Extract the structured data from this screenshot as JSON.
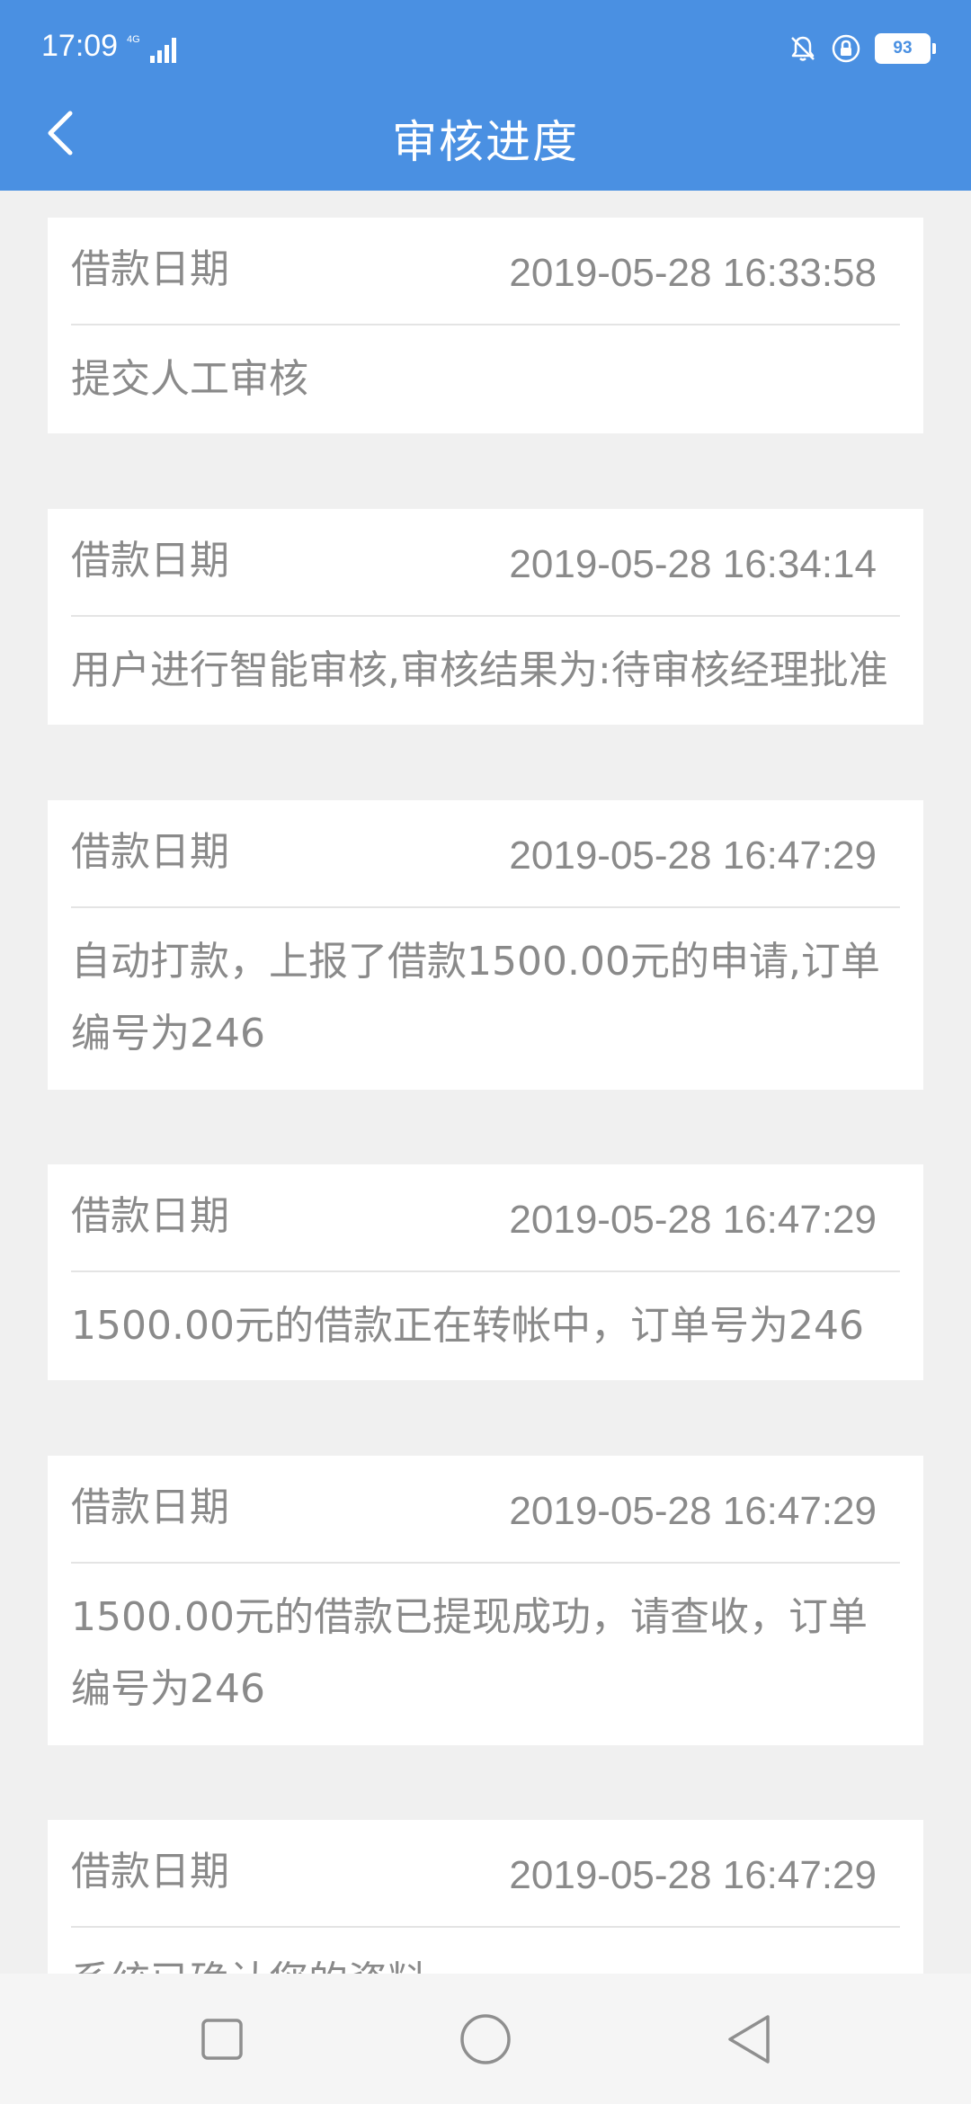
{
  "status_bar": {
    "time": "17:09",
    "network": "4G",
    "battery": "93"
  },
  "header": {
    "title": "审核进度"
  },
  "records": [
    {
      "label": "借款日期",
      "date": "2019-05-28 16:33:58",
      "description": "提交人工审核"
    },
    {
      "label": "借款日期",
      "date": "2019-05-28 16:34:14",
      "description": "用户进行智能审核,审核结果为:待审核经理批准"
    },
    {
      "label": "借款日期",
      "date": "2019-05-28 16:47:29",
      "description": "自动打款，上报了借款1500.00元的申请,订单编号为246"
    },
    {
      "label": "借款日期",
      "date": "2019-05-28 16:47:29",
      "description": "1500.00元的借款正在转帐中，订单号为246"
    },
    {
      "label": "借款日期",
      "date": "2019-05-28 16:47:29",
      "description": "1500.00元的借款已提现成功，请查收，订单编号为246"
    },
    {
      "label": "借款日期",
      "date": "2019-05-28 16:47:29",
      "description": "系统已确认您的资料"
    }
  ],
  "colors": {
    "header": "#4a90e2",
    "page_background": "#f0f0f0",
    "card_background": "#ffffff",
    "text": "#8a8a8a"
  },
  "icons": {
    "back": "chevron-left-icon",
    "bell": "bell-icon",
    "lock": "lock-icon",
    "recent_apps": "square-icon",
    "home": "circle-icon",
    "back_nav": "triangle-left-icon"
  }
}
